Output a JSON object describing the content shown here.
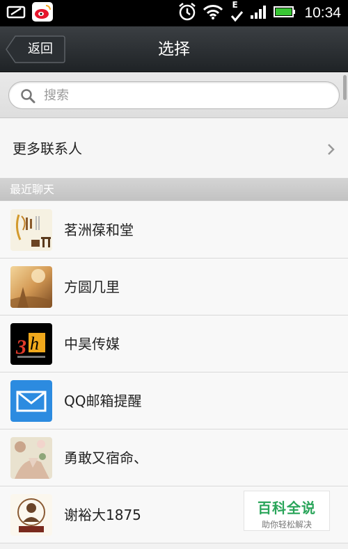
{
  "status_bar": {
    "time": "10:34",
    "left_icons": [
      "screenshot-icon",
      "weibo-icon"
    ],
    "right_icons": [
      "alarm-icon",
      "wifi-icon",
      "edge-network-icon",
      "signal-icon",
      "battery-icon"
    ],
    "network_label": "E"
  },
  "header": {
    "back_label": "返回",
    "title": "选择"
  },
  "search": {
    "placeholder": "搜索"
  },
  "more_contacts": {
    "label": "更多联系人"
  },
  "section": {
    "label": "最近聊天"
  },
  "chats": [
    {
      "name": "茗洲葆和堂"
    },
    {
      "name": "方圆几里"
    },
    {
      "name": "中昊传媒"
    },
    {
      "name": "QQ邮箱提醒"
    },
    {
      "name": "勇敢又宿命、"
    },
    {
      "name": "谢裕大1875"
    }
  ],
  "watermark": {
    "title": "百科全说",
    "subtitle": "助你轻松解决"
  },
  "colors": {
    "title_bar": "#2a2e31",
    "accent_green": "#2aa55a",
    "qq_mail_blue": "#2c8be0"
  }
}
